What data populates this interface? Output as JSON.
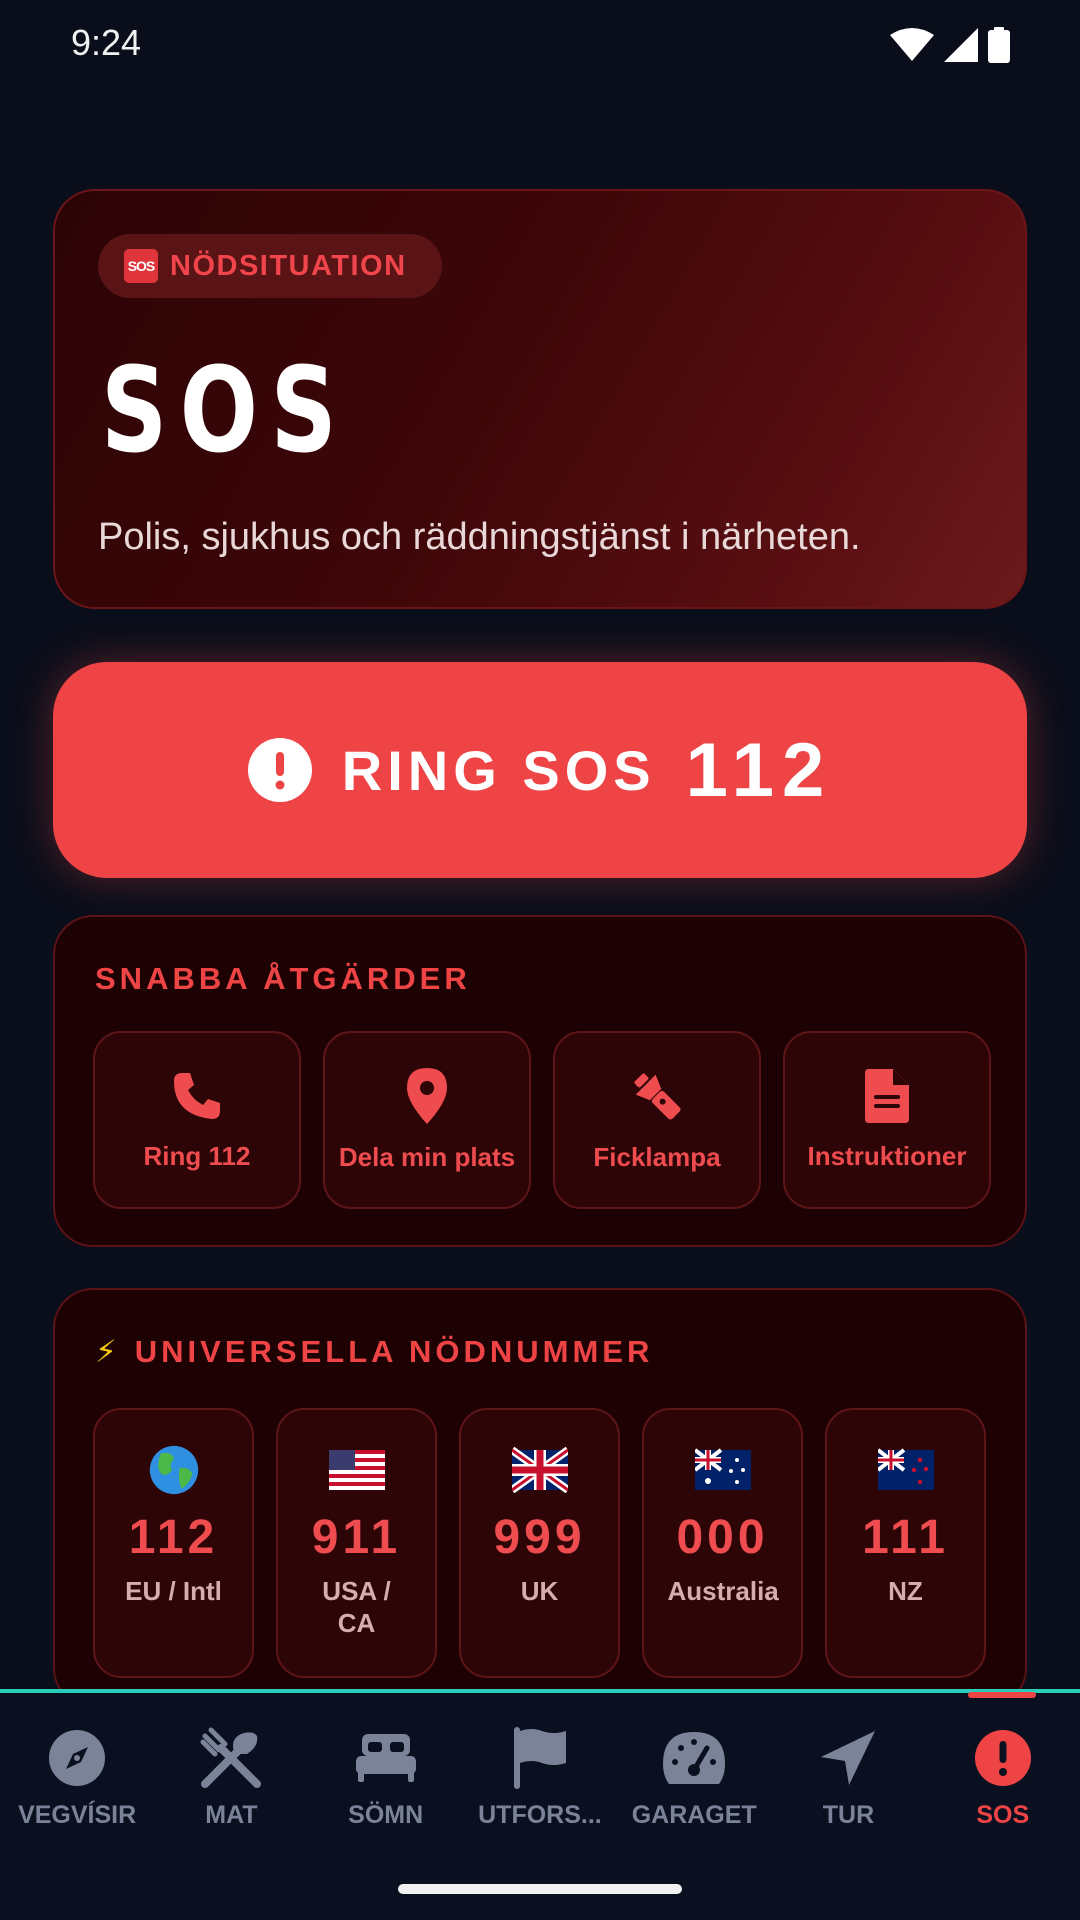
{
  "status_bar": {
    "time": "9:24"
  },
  "hero": {
    "badge_icon": "🆘",
    "badge_label": "NÖDSITUATION",
    "title": "SOS",
    "subtitle": "Polis, sjukhus och räddningstjänst i närheten."
  },
  "call_button": {
    "label": "RING SOS",
    "number": "112",
    "icon": "exclamation-circle-icon"
  },
  "quick_actions": {
    "title": "SNABBA ÅTGÄRDER",
    "items": [
      {
        "label": "Ring 112",
        "icon": "phone-icon"
      },
      {
        "label": "Dela min plats",
        "icon": "map-pin-icon"
      },
      {
        "label": "Ficklampa",
        "icon": "flashlight-icon"
      },
      {
        "label": "Instruktioner",
        "icon": "document-icon"
      }
    ]
  },
  "universal_numbers": {
    "icon": "⚡",
    "title": "UNIVERSELLA NÖDNUMMER",
    "items": [
      {
        "flag": "globe",
        "number": "112",
        "region": "EU / Intl"
      },
      {
        "flag": "usa",
        "number": "911",
        "region": "USA / CA"
      },
      {
        "flag": "uk",
        "number": "999",
        "region": "UK"
      },
      {
        "flag": "australia",
        "number": "000",
        "region": "Australia"
      },
      {
        "flag": "new-zealand",
        "number": "111",
        "region": "NZ"
      }
    ]
  },
  "bottom_nav": {
    "active": "SOS",
    "items": [
      {
        "label": "VEGVÍSIR",
        "icon": "compass-icon"
      },
      {
        "label": "MAT",
        "icon": "utensils-icon"
      },
      {
        "label": "SÖMN",
        "icon": "bed-icon"
      },
      {
        "label": "UTFORS...",
        "icon": "flag-icon"
      },
      {
        "label": "GARAGET",
        "icon": "speedometer-icon"
      },
      {
        "label": "TUR",
        "icon": "navigation-arrow-icon"
      },
      {
        "label": "SOS",
        "icon": "alert-circle-icon"
      }
    ]
  },
  "colors": {
    "background": "#0a0e1a",
    "accent_red": "#ef4446",
    "nav_divider": "#2bcdb9",
    "nav_inactive": "#7b8398"
  }
}
